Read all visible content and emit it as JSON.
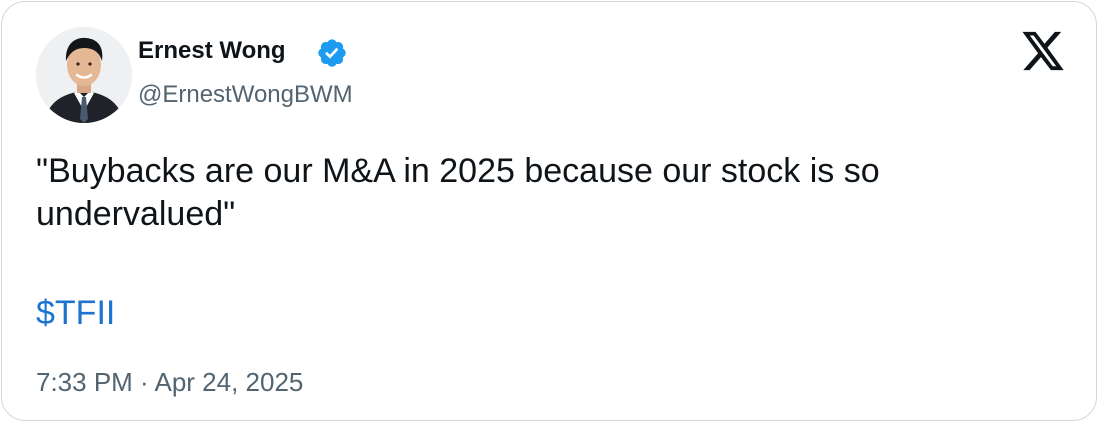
{
  "author": {
    "name": "Ernest Wong",
    "handle": "@ErnestWongBWM",
    "verified": true,
    "avatar": "profile-photo"
  },
  "tweet": {
    "text": "\"Buybacks are our M&A in 2025 because our stock is so undervalued\"",
    "cashtag": "$TFII",
    "timestamp": "7:33 PM · Apr 24, 2025"
  },
  "icons": {
    "verified": "verified-badge-icon",
    "platform": "x-logo-icon"
  },
  "colors": {
    "text": "#0f1419",
    "secondary": "#536471",
    "link": "#1d74d0",
    "verified": "#1d9bf0",
    "border": "#cfd9de"
  }
}
